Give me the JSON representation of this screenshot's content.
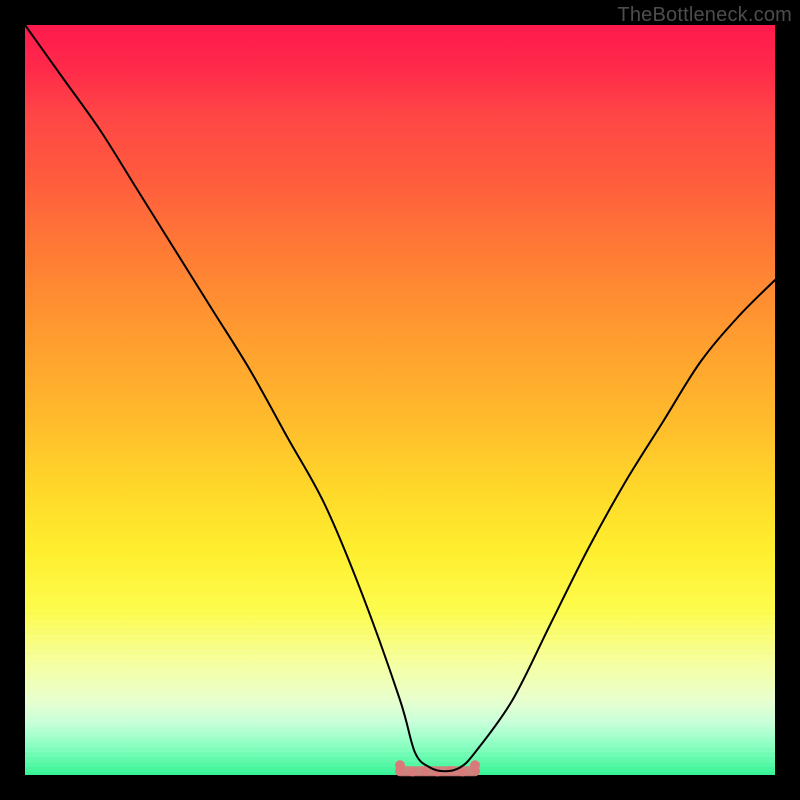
{
  "watermark": "TheBottleneck.com",
  "chart_data": {
    "type": "line",
    "title": "",
    "xlabel": "",
    "ylabel": "",
    "xlim": [
      0,
      100
    ],
    "ylim": [
      0,
      100
    ],
    "grid": false,
    "legend": false,
    "series": [
      {
        "name": "bottleneck-curve",
        "x": [
          0,
          5,
          10,
          15,
          20,
          25,
          30,
          35,
          40,
          45,
          50,
          52,
          54,
          56,
          58,
          60,
          65,
          70,
          75,
          80,
          85,
          90,
          95,
          100
        ],
        "values": [
          100,
          93,
          86,
          78,
          70,
          62,
          54,
          45,
          36,
          24,
          10,
          3,
          1,
          0.5,
          1,
          3,
          10,
          20,
          30,
          39,
          47,
          55,
          61,
          66
        ]
      }
    ],
    "highlight": {
      "name": "bottom-band",
      "x_range": [
        50,
        60
      ],
      "value": 0.5,
      "color": "#d97a7a"
    },
    "background_gradient_vertical": [
      "#ff1a4d",
      "#ff4646",
      "#ff7a35",
      "#ffb92c",
      "#ffee2e",
      "#fdfc4d",
      "#e9ffcf",
      "#8dffc3",
      "#35f596"
    ]
  }
}
